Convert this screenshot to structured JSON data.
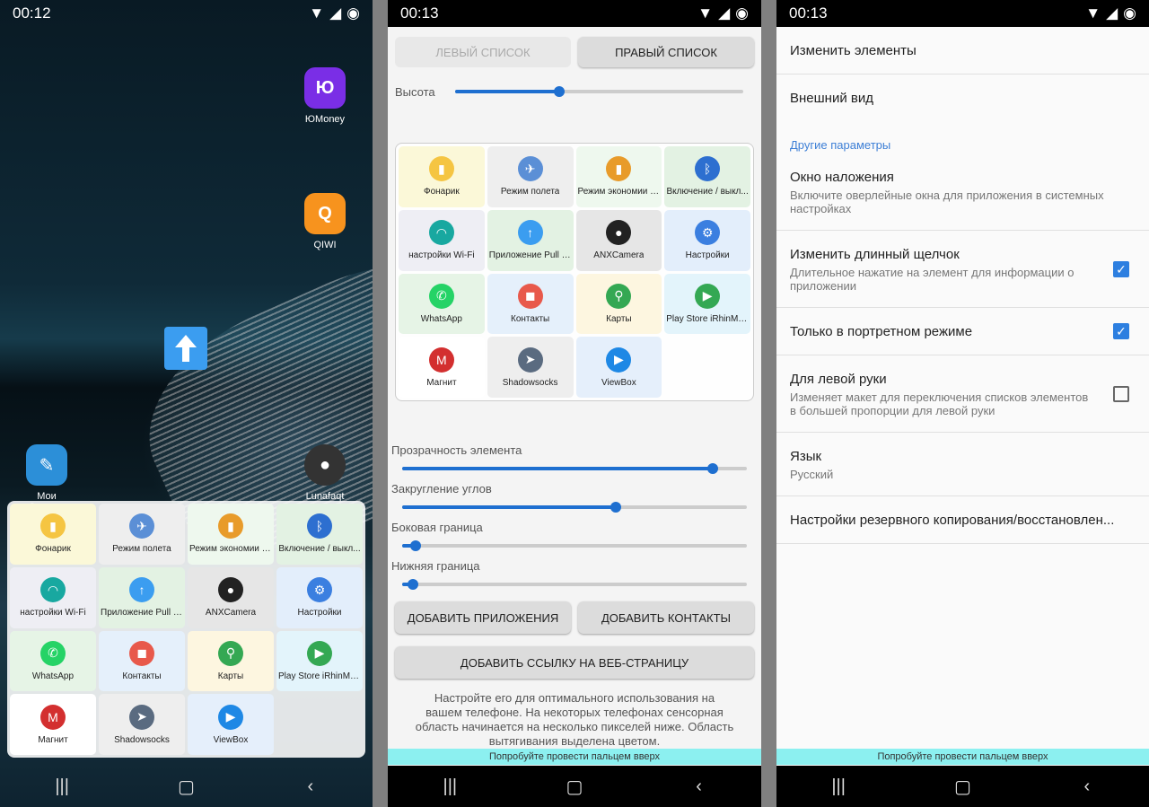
{
  "screen1": {
    "time": "00:12",
    "apps": {
      "yumoney": "ЮMoney",
      "qiwi": "QIWI",
      "notes": "Мои Замет...",
      "lunafaqt": "Lunafaqt"
    },
    "tiles": [
      {
        "label": "Фонарик",
        "icon": "flashlight-icon",
        "bg": "#fbf8d8"
      },
      {
        "label": "Режим полета",
        "icon": "airplane-icon",
        "bg": "#eeeeee"
      },
      {
        "label": "Режим экономии з...",
        "icon": "battery-icon",
        "bg": "#eef8ee"
      },
      {
        "label": "Включение / выкл...",
        "icon": "bluetooth-icon",
        "bg": "#e3f2e3"
      },
      {
        "label": "настройки Wi-Fi",
        "icon": "wifi-icon",
        "bg": "#eeeef4"
      },
      {
        "label": "Приложение Pull M...",
        "icon": "pull-menu-icon",
        "bg": "#e3f2e3"
      },
      {
        "label": "ANXCamera",
        "icon": "camera-icon",
        "bg": "#e6e6e6"
      },
      {
        "label": "Настройки",
        "icon": "settings-icon",
        "bg": "#e3eefb"
      },
      {
        "label": "WhatsApp",
        "icon": "whatsapp-icon",
        "bg": "#e6f4e6"
      },
      {
        "label": "Контакты",
        "icon": "contacts-icon",
        "bg": "#e5f0fb"
      },
      {
        "label": "Карты",
        "icon": "maps-icon",
        "bg": "#fdf6e0"
      },
      {
        "label": "Play Store iRhinMod®",
        "icon": "play-store-icon",
        "bg": "#e3f4fb"
      },
      {
        "label": "Магнит",
        "icon": "magnit-icon",
        "bg": "#ffffff"
      },
      {
        "label": "Shadowsocks",
        "icon": "shadowsocks-icon",
        "bg": "#eeeeee"
      },
      {
        "label": "ViewBox",
        "icon": "viewbox-icon",
        "bg": "#e5effb"
      }
    ]
  },
  "screen2": {
    "time": "00:13",
    "tab_left": "ЛЕВЫЙ СПИСОК",
    "tab_right": "ПРАВЫЙ СПИСОК",
    "height_label": "Высота",
    "height_value": 0.36,
    "tiles": [
      {
        "label": "Фонарик"
      },
      {
        "label": "Режим полета"
      },
      {
        "label": "Режим экономии з..."
      },
      {
        "label": "Включение / выкл..."
      },
      {
        "label": "настройки Wi-Fi"
      },
      {
        "label": "Приложение Pull M..."
      },
      {
        "label": "ANXCamera"
      },
      {
        "label": "Настройки"
      },
      {
        "label": "WhatsApp"
      },
      {
        "label": "Контакты"
      },
      {
        "label": "Карты"
      },
      {
        "label": "Play Store iRhinMod..."
      },
      {
        "label": "Магнит"
      },
      {
        "label": "Shadowsocks"
      },
      {
        "label": "ViewBox"
      }
    ],
    "sliders": [
      {
        "label": "Прозрачность элемента",
        "value": 0.9
      },
      {
        "label": "Закругление углов",
        "value": 0.62
      },
      {
        "label": "Боковая граница",
        "value": 0.04
      },
      {
        "label": "Нижняя граница",
        "value": 0.03
      }
    ],
    "add_apps": "ДОБАВИТЬ ПРИЛОЖЕНИЯ",
    "add_contacts": "ДОБАВИТЬ КОНТАКТЫ",
    "add_link": "ДОБАВИТЬ ССЫЛКУ НА ВЕБ-СТРАНИЦУ",
    "hint": "Настройте его для оптимального использования на вашем телефоне. На некоторых телефонах сенсорная область начинается на несколько пикселей ниже. Область вытягивания выделена цветом.",
    "swipe_hint": "Попробуйте провести пальцем вверх"
  },
  "screen3": {
    "time": "00:13",
    "edit_items": "Изменить элементы",
    "appearance": "Внешний вид",
    "other_params": "Другие параметры",
    "overlay_title": "Окно наложения",
    "overlay_desc": "Включите оверлейные окна для приложения в системных настройках",
    "longclick_title": "Изменить длинный щелчок",
    "longclick_desc": "Длительное нажатие на элемент для информации о приложении",
    "longclick_checked": true,
    "portrait_title": "Только в портретном режиме",
    "portrait_checked": true,
    "lefthand_title": "Для левой руки",
    "lefthand_desc": "Изменяет макет для переключения списков элементов в большей пропорции для левой руки",
    "lefthand_checked": false,
    "language_title": "Язык",
    "language_value": "Русский",
    "backup_title": "Настройки резервного копирования/восстановлен...",
    "swipe_hint": "Попробуйте провести пальцем вверх"
  },
  "colors": {
    "accent": "#1e6fd0",
    "swipe_area": "#8cf0f0",
    "float_button": "#3b9df0"
  }
}
